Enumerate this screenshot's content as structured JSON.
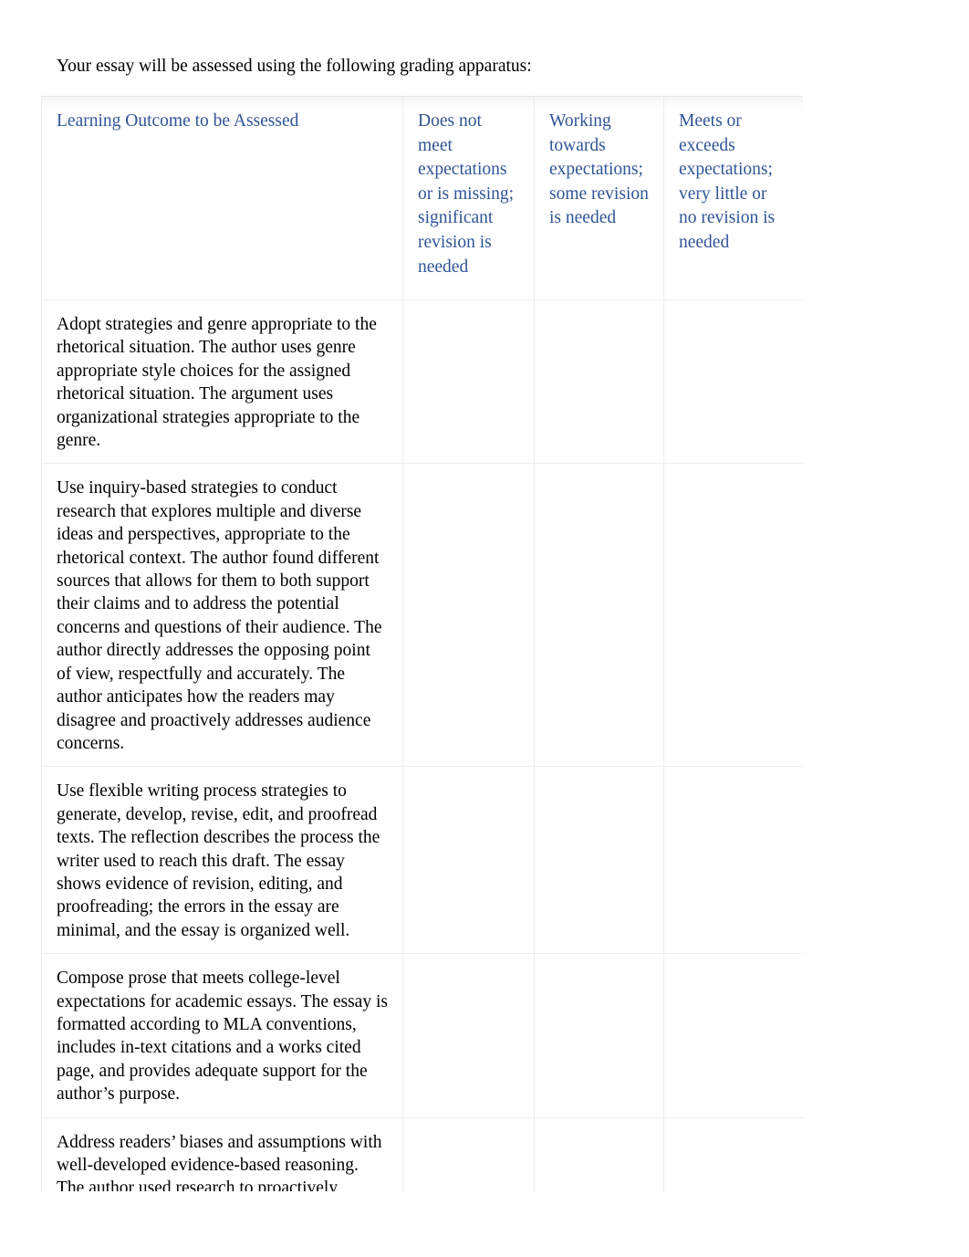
{
  "document": {
    "intro_text": "Your essay will be assessed using the following grading apparatus:"
  },
  "rubric_table": {
    "columns": [
      {
        "key": "outcome",
        "label": "Learning Outcome to be Assessed"
      },
      {
        "key": "level_1",
        "label": "Does not meet expectations or is missing; significant revision is needed"
      },
      {
        "key": "level_2",
        "label": "Working towards expectations; some revision is needed"
      },
      {
        "key": "level_3",
        "label": "Meets or exceeds expectations; very little or no revision is needed"
      }
    ],
    "rows": [
      {
        "outcome": "Adopt strategies and genre appropriate to the rhetorical situation.   The author uses genre appropriate style choices for the assigned rhetorical situation. The argument uses organizational strategies appropriate to the genre.",
        "level_1": "",
        "level_2": "",
        "level_3": ""
      },
      {
        "outcome": "Use inquiry-based strategies to conduct research that explores multiple and diverse ideas and perspectives, appropriate to the rhetorical context.    The author found different sources that allows for them to both support their claims and to address the potential concerns and questions of their audience.   The author directly addresses the opposing point of view, respectfully and accurately. The author anticipates how the readers may disagree and proactively addresses audience concerns.",
        "level_1": "",
        "level_2": "",
        "level_3": ""
      },
      {
        "outcome": "Use flexible writing process strategies to generate, develop, revise, edit, and proofread texts.   The reflection describes the process the writer used to reach this draft. The essay shows evidence of revision, editing, and proofreading; the errors in the essay are minimal, and the essay is organized well.",
        "level_1": "",
        "level_2": "",
        "level_3": ""
      },
      {
        "outcome": "Compose prose that meets college-level expectations for academic essays.   The essay is formatted according to MLA conventions, includes in-text citations and a works cited page, and provides adequate support for the author’s purpose.",
        "level_1": "",
        "level_2": "",
        "level_3": ""
      },
      {
        "outcome": "Address readers’ biases and assumptions with well-developed evidence-based reasoning.  The author used research to proactively address possible reader concerns. The proposal was written in a",
        "level_1": "",
        "level_2": "",
        "level_3": ""
      }
    ]
  },
  "colors": {
    "header_text": "#2f5496",
    "body_text": "#000000",
    "border": "#ededed",
    "page_background": "#ffffff"
  }
}
